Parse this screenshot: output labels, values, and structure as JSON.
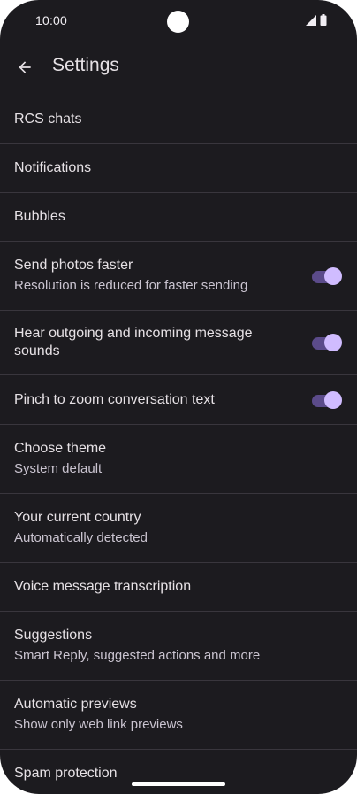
{
  "status_bar": {
    "time": "10:00",
    "icons": [
      "cellular-signal-icon",
      "battery-icon"
    ]
  },
  "app_bar": {
    "back_icon": "arrow-back-icon",
    "title": "Settings"
  },
  "settings": [
    {
      "title": "RCS chats",
      "subtitle": null,
      "toggle": null
    },
    {
      "title": "Notifications",
      "subtitle": null,
      "toggle": null
    },
    {
      "title": "Bubbles",
      "subtitle": null,
      "toggle": null
    },
    {
      "title": "Send photos faster",
      "subtitle": "Resolution is reduced for faster sending",
      "toggle": true
    },
    {
      "title": "Hear outgoing and incoming message sounds",
      "subtitle": null,
      "toggle": true
    },
    {
      "title": "Pinch to zoom conversation text",
      "subtitle": null,
      "toggle": true
    },
    {
      "title": "Choose theme",
      "subtitle": "System default",
      "toggle": null
    },
    {
      "title": "Your current country",
      "subtitle": "Automatically detected",
      "toggle": null
    },
    {
      "title": "Voice message transcription",
      "subtitle": null,
      "toggle": null
    },
    {
      "title": "Suggestions",
      "subtitle": "Smart Reply, suggested actions and more",
      "toggle": null
    },
    {
      "title": "Automatic previews",
      "subtitle": "Show only web link previews",
      "toggle": null
    },
    {
      "title": "Spam protection",
      "subtitle": null,
      "toggle": null
    }
  ],
  "colors": {
    "background": "#1c1b1f",
    "toggle_track_on": "#5b4b8a",
    "toggle_thumb_on": "#d0bcff",
    "divider": "#39363d"
  }
}
